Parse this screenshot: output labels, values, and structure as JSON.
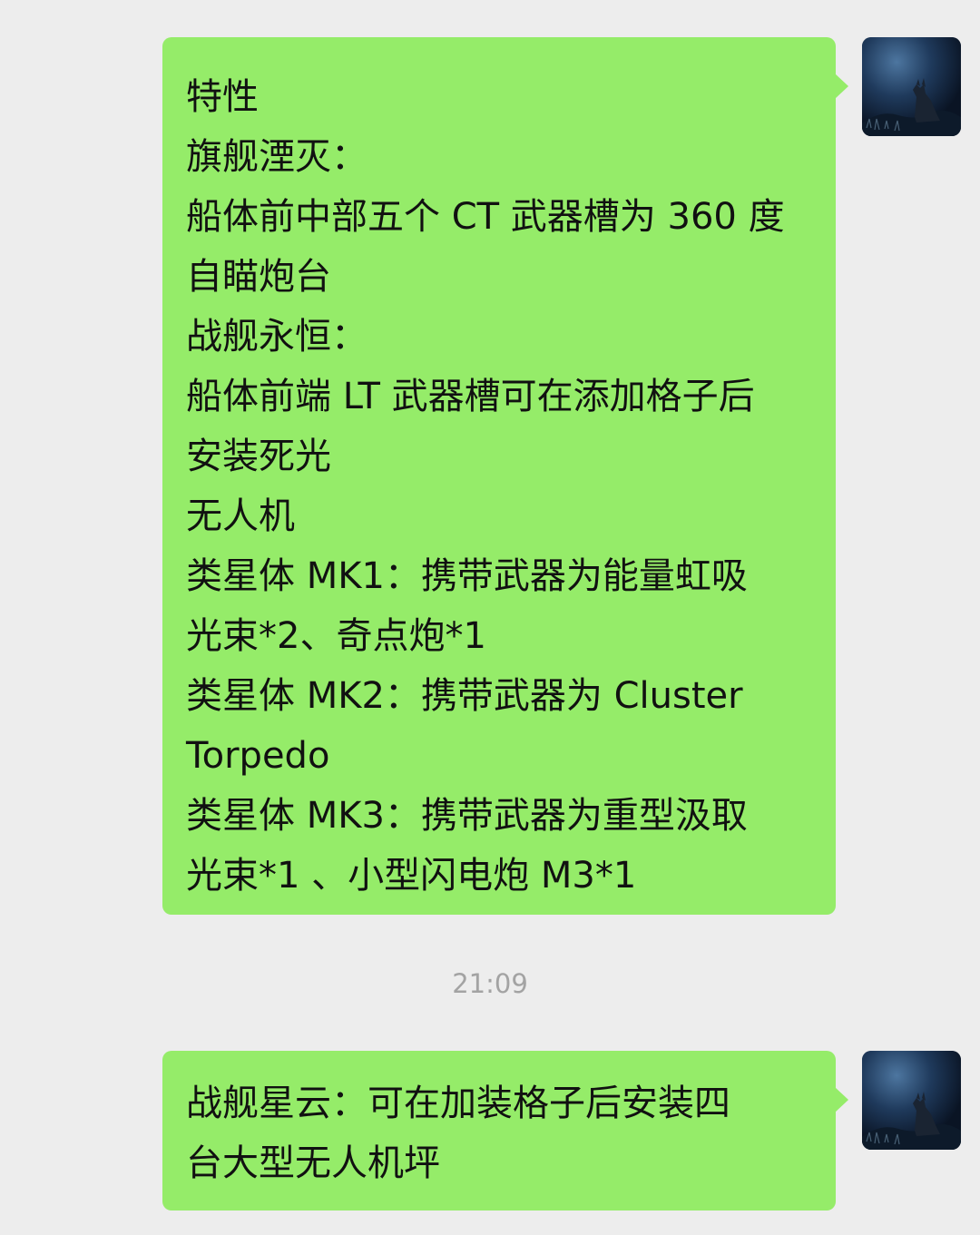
{
  "conversation": {
    "messages": [
      {
        "sender": "self",
        "lines": [
          "特性",
          "旗舰湮灭：",
          "船体前中部五个 CT 武器槽为 360 度",
          "自瞄炮台",
          "战舰永恒：",
          "船体前端 LT 武器槽可在添加格子后",
          "安装死光",
          "无人机",
          "类星体 MK1：携带武器为能量虹吸",
          "光束*2、奇点炮*1",
          "类星体 MK2：携带武器为 Cluster",
          "Torpedo",
          "类星体 MK3：携带武器为重型汲取",
          "光束*1 、小型闪电炮 M3*1"
        ]
      },
      {
        "sender": "self",
        "lines": [
          "战舰星云：可在加装格子后安装四",
          "台大型无人机坪"
        ]
      }
    ],
    "timestamp": "21:09"
  },
  "colors": {
    "background": "#ededed",
    "bubble": "#95ec69",
    "text": "#111111",
    "timestamp": "#a3a3a3"
  },
  "icons": {
    "avatar": "wolf-night-avatar"
  }
}
